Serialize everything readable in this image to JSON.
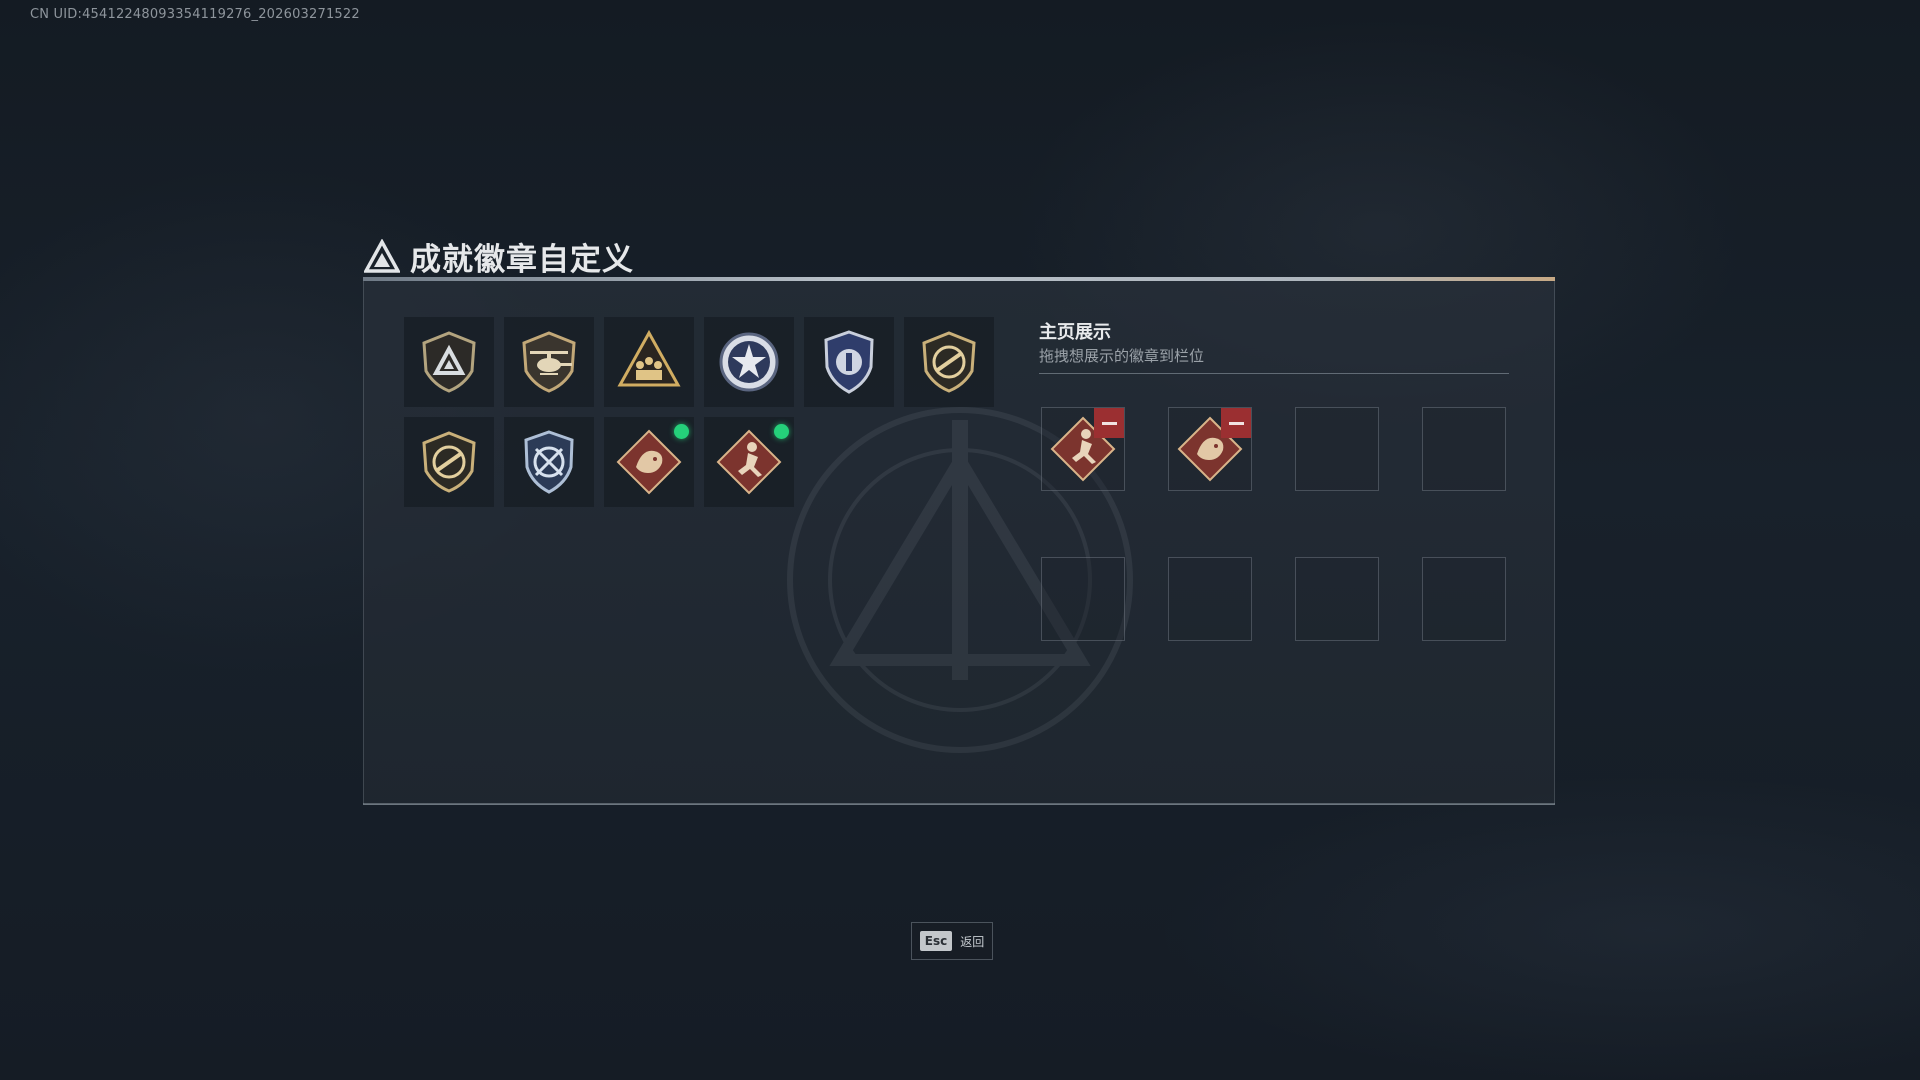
{
  "uid_text": "CN UID:4541224809335411927​6_202603271522",
  "dialog": {
    "title": "成就徽章自定义",
    "logo_icon": "faction-triangle-icon"
  },
  "badges": [
    {
      "icon": "triangle-shield-badge-icon",
      "new": false
    },
    {
      "icon": "helicopter-shield-badge-icon",
      "new": false
    },
    {
      "icon": "squad-triangle-badge-icon",
      "new": false
    },
    {
      "icon": "star-medal-badge-icon",
      "new": false
    },
    {
      "icon": "police-crest-badge-icon",
      "new": false
    },
    {
      "icon": "rifle-shield-badge-icon",
      "new": false
    },
    {
      "icon": "rifle-shield-badge-icon",
      "new": false
    },
    {
      "icon": "crossed-arrows-crest-badge-icon",
      "new": false
    },
    {
      "icon": "dragon-diamond-badge-icon",
      "new": true
    },
    {
      "icon": "runner-diamond-badge-icon",
      "new": true
    }
  ],
  "homepage_display": {
    "title": "主页展示",
    "subtitle": "拖拽想展示的徽章到栏位",
    "slots": [
      {
        "icon": "runner-diamond-badge-icon",
        "filled": true
      },
      {
        "icon": "dragon-diamond-badge-icon",
        "filled": true
      },
      {
        "filled": false
      },
      {
        "filled": false
      },
      {
        "filled": false
      },
      {
        "filled": false
      },
      {
        "filled": false
      },
      {
        "filled": false
      }
    ]
  },
  "footer": {
    "esc_key": "Esc",
    "back_label": "返回"
  },
  "colors": {
    "new_indicator": "#25d07a",
    "remove_button": "#9b2f31",
    "badge_gold": "#c9a86a",
    "badge_red": "#8c3b33"
  }
}
